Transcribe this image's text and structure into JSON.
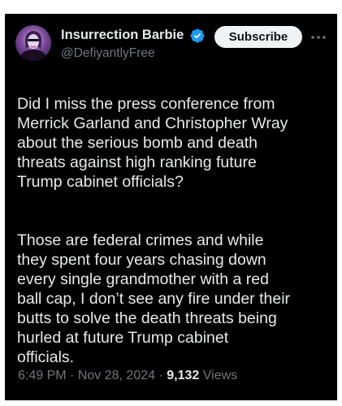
{
  "header": {
    "display_name": "Insurrection Barbie",
    "handle": "@DefiyantlyFree",
    "subscribe_label": "Subscribe"
  },
  "tweet": {
    "paragraphs": [
      "Did I miss the press conference from\nMerrick Garland and Christopher Wray\nabout the serious bomb and death\nthreats against high ranking future\nTrump cabinet officials?",
      "Those are federal crimes and while\nthey spent four years chasing down\nevery single grandmother with a red\nball cap, I don’t see any fire under their\nbutts to solve the death threats being\nhurled at future Trump cabinet\nofficials."
    ]
  },
  "meta": {
    "time": "6:49 PM",
    "separator": "·",
    "date": "Nov 28, 2024",
    "views_count": "9,132",
    "views_label": "Views"
  },
  "colors": {
    "background": "#000000",
    "text_primary": "#e7e9ea",
    "text_secondary": "#71767b",
    "verified_badge": "#1d9bf0",
    "button_bg": "#eff3f4"
  },
  "icons": {
    "verified": "verified-badge-icon",
    "more": "more-horizontal-icon"
  }
}
